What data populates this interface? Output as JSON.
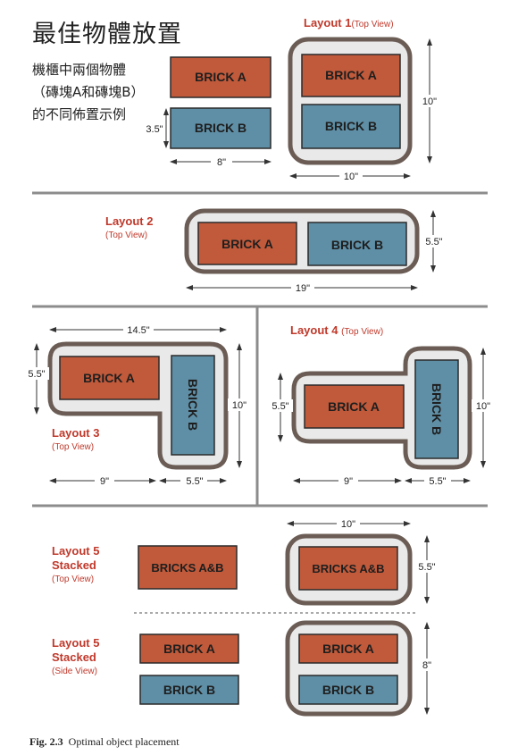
{
  "title": "最佳物體放置",
  "intro": "機櫃中兩個物體（磚塊A和磚塊B）的不同佈置示例",
  "colors": {
    "brick_a": "#c15a3b",
    "brick_b": "#5f8fa6",
    "container_fill": "#e9e9e9",
    "container_stroke": "#6b5d55",
    "label_red": "#c0392b",
    "divider": "#8c8c8c"
  },
  "bricks": {
    "a": "BRICK A",
    "b": "BRICK B",
    "ab": "BRICKS A&B"
  },
  "layouts": {
    "l1": {
      "name": "Layout 1",
      "view": "(Top View)"
    },
    "l2": {
      "name": "Layout 2",
      "view": "(Top View)"
    },
    "l3": {
      "name": "Layout 3",
      "view": "(Top View)"
    },
    "l4": {
      "name": "Layout 4",
      "view": "(Top View)"
    },
    "l5_top": {
      "name": "Layout 5",
      "name2": "Stacked",
      "view": "(Top View)"
    },
    "l5_side": {
      "name": "Layout 5",
      "name2": "Stacked",
      "view": "(Side View)"
    }
  },
  "dims": {
    "d_3_5": "3.5\"",
    "d_8": "8\"",
    "d_10": "10\"",
    "d_5_5": "5.5\"",
    "d_19": "19\"",
    "d_14_5": "14.5\"",
    "d_9": "9\"",
    "d_8b": "8\""
  },
  "caption": {
    "fig": "Fig. 2.3",
    "text": "Optimal object placement"
  }
}
